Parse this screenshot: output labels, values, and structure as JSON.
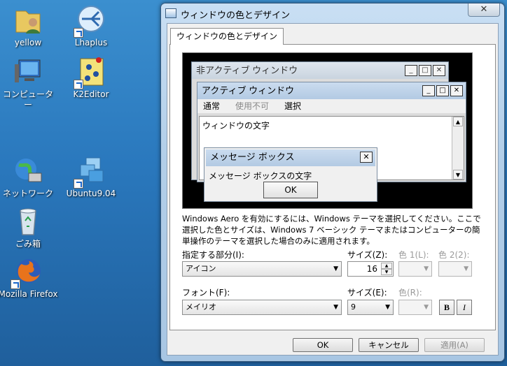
{
  "desktop": {
    "icons": [
      {
        "label": "yellow"
      },
      {
        "label": "Lhaplus"
      },
      {
        "label": "コンピュータ\nー"
      },
      {
        "label": "K2Editor"
      },
      {
        "label": "ネットワーク"
      },
      {
        "label": "Ubuntu9.04"
      },
      {
        "label": "ごみ箱"
      },
      {
        "label": "Mozilla Firefox"
      }
    ]
  },
  "dialog": {
    "title": "ウィンドウの色とデザイン",
    "close_glyph": "✕",
    "tab_label": "ウィンドウの色とデザイン",
    "preview": {
      "inactive_title": "非アクティブ ウィンドウ",
      "active_title": "アクティブ ウィンドウ",
      "menu_normal": "通常",
      "menu_disabled": "使用不可",
      "menu_selected": "選択",
      "window_text": "ウィンドウの文字",
      "msgbox_title": "メッセージ ボックス",
      "msgbox_text": "メッセージ ボックスの文字",
      "msgbox_ok": "OK",
      "min_glyph": "_",
      "max_glyph": "□",
      "close_glyph": "✕"
    },
    "description": "Windows Aero を有効にするには、Windows テーマを選択してください。ここで選択した色とサイズは、Windows 7 ベーシック テーマまたはコンピューターの簡単操作のテーマを選択した場合のみに適用されます。",
    "item_label": "指定する部分(I):",
    "item_value": "アイコン",
    "item_size_label": "サイズ(Z):",
    "item_size_value": "16",
    "color1_label": "色 1(L):",
    "color2_label": "色 2(2):",
    "font_label": "フォント(F):",
    "font_value": "メイリオ",
    "font_size_label": "サイズ(E):",
    "font_size_value": "9",
    "font_color_label": "色(R):",
    "bold_label": "B",
    "italic_label": "I",
    "ok": "OK",
    "cancel": "キャンセル",
    "apply": "適用(A)"
  }
}
